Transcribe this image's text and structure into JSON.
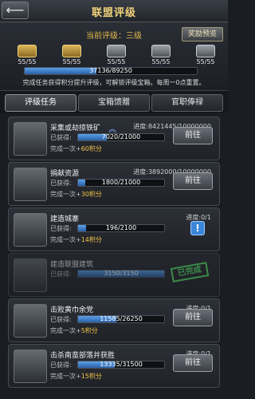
{
  "window": {
    "title": "联盟评级",
    "back_icon": "back-arrow-icon",
    "reward_preview_label": "奖励预览"
  },
  "league": {
    "current_level_text": "当前评级：三级",
    "chests": [
      {
        "type": "gold",
        "count": "55/55"
      },
      {
        "type": "gold",
        "count": "55/55"
      },
      {
        "type": "silver",
        "count": "55/55"
      },
      {
        "type": "silver",
        "count": "55/55"
      },
      {
        "type": "silver",
        "count": "55/55"
      }
    ],
    "progress_text": "37136/89250",
    "progress_value": 37136,
    "progress_max": 89250,
    "hint": "完成任务获得积分提升评级，可解锁评级宝箱。每周一0点重置。"
  },
  "tabs": [
    {
      "label": "评级任务",
      "active": true
    },
    {
      "label": "宝箱馈赠",
      "active": false
    },
    {
      "label": "官职俸禄",
      "active": false
    }
  ],
  "tasks": [
    {
      "name": "采集或劫掠铁矿",
      "progress": "进度:8421445/10000000",
      "obtained_label": "已获得:",
      "bar_text": "7020/21000",
      "bar_value": 7020,
      "bar_max": 21000,
      "done_text": "完成一次+",
      "points": "60积分",
      "action": "前往",
      "icon": "iron-ore-icon",
      "completed": false,
      "show_info": false,
      "has_up": true
    },
    {
      "name": "捐献资源",
      "progress": "进度:3892000/10000000",
      "obtained_label": "已获得:",
      "bar_text": "1800/21000",
      "bar_value": 1800,
      "bar_max": 21000,
      "done_text": "完成一次+",
      "points": "30积分",
      "action": "前往",
      "icon": "resources-icon",
      "completed": false,
      "show_info": false,
      "has_up": false
    },
    {
      "name": "建造城寨",
      "progress": "进度:0/1",
      "obtained_label": "已获得:",
      "bar_text": "196/2100",
      "bar_value": 196,
      "bar_max": 2100,
      "done_text": "完成一次+",
      "points": "14积分",
      "action": "",
      "icon": "fortress-icon",
      "completed": false,
      "show_info": true,
      "has_up": false
    },
    {
      "name": "建造联盟建筑",
      "progress": "",
      "obtained_label": "已获得:",
      "bar_text": "3150/3150",
      "bar_value": 3150,
      "bar_max": 3150,
      "done_text": "",
      "points": "",
      "action": "",
      "icon": "alliance-building-icon",
      "completed": true,
      "show_info": false,
      "has_up": false,
      "stamp": "已完成"
    },
    {
      "name": "击败黄巾余党",
      "progress": "进度:0/1",
      "obtained_label": "已获得:",
      "bar_text": "11585/26250",
      "bar_value": 11585,
      "bar_max": 26250,
      "done_text": "完成一次+",
      "points": "5积分",
      "action": "前往",
      "icon": "yellow-turban-icon",
      "completed": false,
      "show_info": false,
      "has_up": false
    },
    {
      "name": "击杀南蛮部落并获胜",
      "progress": "进度:0/1",
      "obtained_label": "已获得:",
      "bar_text": "13335/31500",
      "bar_value": 13335,
      "bar_max": 31500,
      "done_text": "完成一次+",
      "points": "15积分",
      "action": "前往",
      "icon": "barbarian-tribe-icon",
      "completed": false,
      "show_info": false,
      "has_up": false
    }
  ],
  "colors": {
    "accent_gold": "#e2b84a",
    "bar_blue": "#3b7bd0",
    "completed_green": "#58e36a"
  }
}
